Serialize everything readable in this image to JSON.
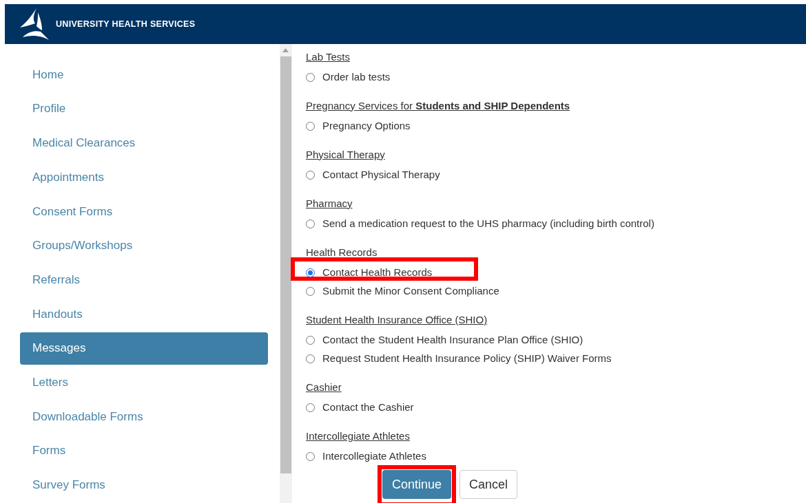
{
  "header": {
    "title": "UNIVERSITY HEALTH SERVICES"
  },
  "sidebar": {
    "items": [
      {
        "label": "Home",
        "selected": false
      },
      {
        "label": "Profile",
        "selected": false
      },
      {
        "label": "Medical Clearances",
        "selected": false
      },
      {
        "label": "Appointments",
        "selected": false
      },
      {
        "label": "Consent Forms",
        "selected": false
      },
      {
        "label": "Groups/Workshops",
        "selected": false
      },
      {
        "label": "Referrals",
        "selected": false
      },
      {
        "label": "Handouts",
        "selected": false
      },
      {
        "label": "Messages",
        "selected": true
      },
      {
        "label": "Letters",
        "selected": false
      },
      {
        "label": "Downloadable Forms",
        "selected": false
      },
      {
        "label": "Forms",
        "selected": false
      },
      {
        "label": "Survey Forms",
        "selected": false
      }
    ]
  },
  "groups": [
    {
      "heading": "Lab Tests",
      "link": true,
      "options": [
        {
          "label": "Order lab tests",
          "selected": false,
          "highlighted": false
        }
      ]
    },
    {
      "heading": "Pregnancy Services for **Students and SHIP Dependents**",
      "link": true,
      "options": [
        {
          "label": "Pregnancy Options",
          "selected": false,
          "highlighted": false
        }
      ]
    },
    {
      "heading": "Physical Therapy",
      "link": true,
      "options": [
        {
          "label": "Contact Physical Therapy",
          "selected": false,
          "highlighted": false
        }
      ]
    },
    {
      "heading": "Pharmacy",
      "link": true,
      "options": [
        {
          "label": "Send a medication request to the UHS pharmacy (including birth control)",
          "selected": false,
          "highlighted": false
        }
      ]
    },
    {
      "heading": "Health Records",
      "link": false,
      "options": [
        {
          "label": "Contact Health Records",
          "selected": true,
          "highlighted": true
        },
        {
          "label": "Submit the Minor Consent Compliance",
          "selected": false,
          "highlighted": false
        }
      ]
    },
    {
      "heading": "Student Health Insurance Office (SHIO)",
      "link": true,
      "options": [
        {
          "label": "Contact the Student Health Insurance Plan Office (SHIO)",
          "selected": false,
          "highlighted": false
        },
        {
          "label": "Request Student Health Insurance Policy (SHIP) Waiver Forms",
          "selected": false,
          "highlighted": false
        }
      ]
    },
    {
      "heading": "Cashier",
      "link": true,
      "options": [
        {
          "label": "Contact the Cashier",
          "selected": false,
          "highlighted": false
        }
      ]
    },
    {
      "heading": "Intercollegiate Athletes",
      "link": true,
      "options": [
        {
          "label": "Intercollegiate Athletes",
          "selected": false,
          "highlighted": false
        }
      ]
    }
  ],
  "buttons": [
    {
      "label": "Continue",
      "kind": "primary",
      "highlighted": true
    },
    {
      "label": "Cancel",
      "kind": "secondary",
      "highlighted": false
    }
  ]
}
